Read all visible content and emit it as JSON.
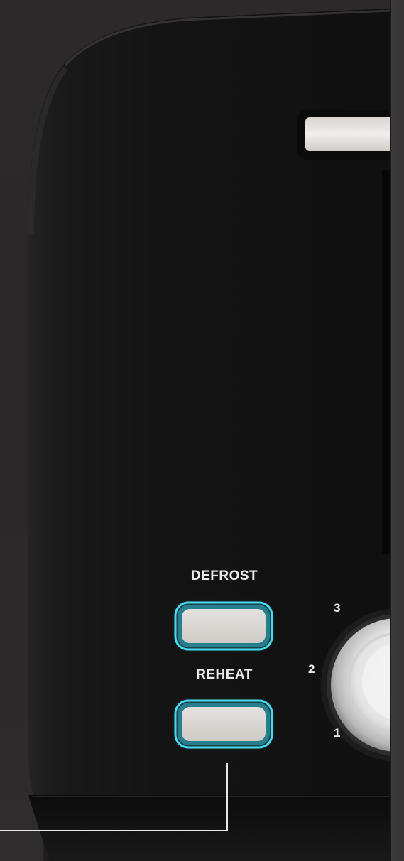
{
  "controls": {
    "defrost": {
      "label": "DEFROST"
    },
    "reheat": {
      "label": "REHEAT"
    }
  },
  "browning_dial": {
    "levels": [
      "3",
      "2",
      "1"
    ]
  },
  "colors": {
    "background": "#2a2829",
    "toaster_body": "#151515",
    "button_glow": "#37d6f0",
    "button_face": "#d9d6d3",
    "label_text": "#e9e9e9",
    "callout_line": "#e6e6e6"
  },
  "icons": {
    "browning-dial": "silver-knob",
    "bread-slot": "slot-opening"
  }
}
